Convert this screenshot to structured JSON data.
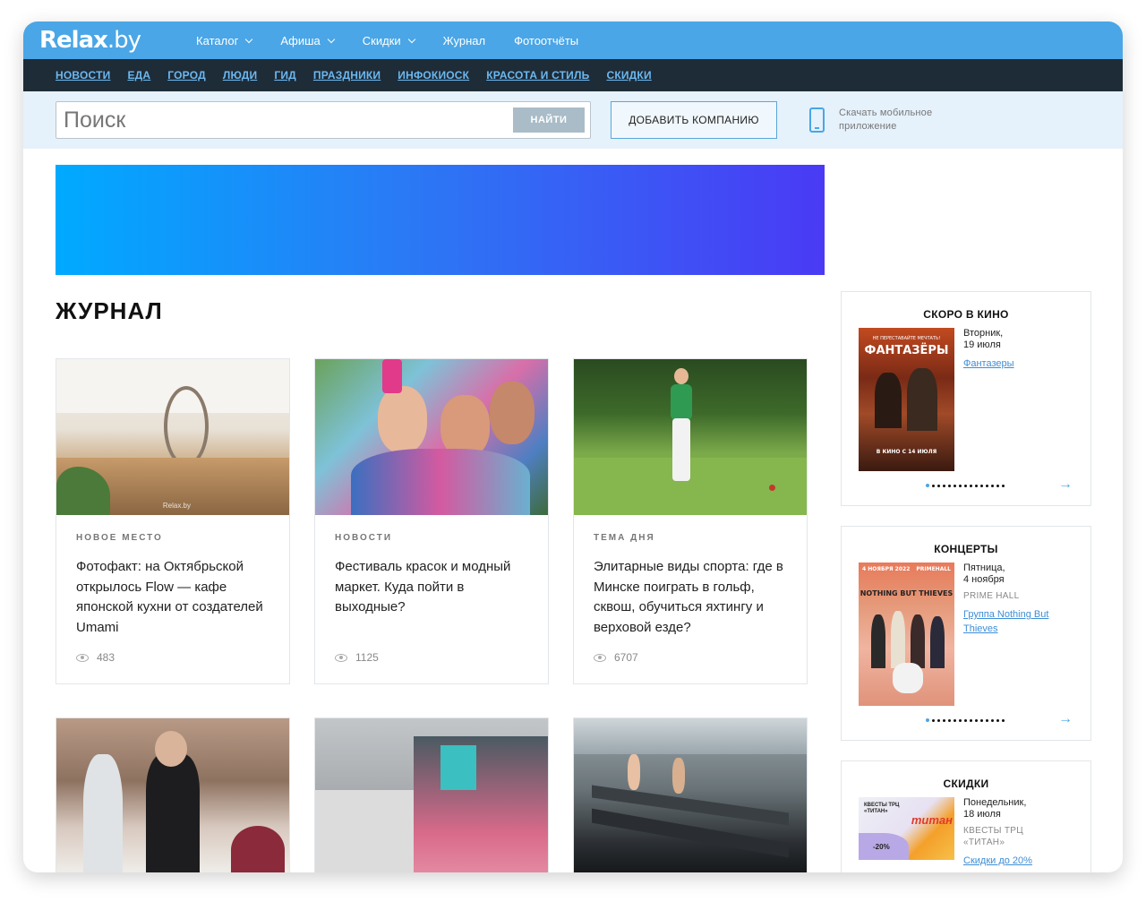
{
  "brand": {
    "logo_main": "Relax",
    "logo_tld": ".by"
  },
  "topnav": [
    {
      "label": "Каталог",
      "dropdown": true
    },
    {
      "label": "Афиша",
      "dropdown": true
    },
    {
      "label": "Скидки",
      "dropdown": true
    },
    {
      "label": "Журнал",
      "dropdown": false
    },
    {
      "label": "Фотоотчёты",
      "dropdown": false
    }
  ],
  "categories": [
    "НОВОСТИ",
    "ЕДА",
    "ГОРОД",
    "ЛЮДИ",
    "ГИД",
    "ПРАЗДНИКИ",
    "ИНФОКИОСК",
    "КРАСОТА И СТИЛЬ",
    "СКИДКИ"
  ],
  "search": {
    "placeholder": "Поиск",
    "button_label": "НАЙТИ"
  },
  "add_company_label": "ДОБАВИТЬ КОМПАНИЮ",
  "mobile_app_text": "Скачать мобильное приложение",
  "section_title": "ЖУРНАЛ",
  "articles": [
    {
      "tag": "НОВОЕ МЕСТО",
      "title": "Фотофакт: на Октябрьской открылось Flow — кафе японской кухни от создателей Umami",
      "views": "483",
      "watermark": "Relax.by"
    },
    {
      "tag": "НОВОСТИ",
      "title": "Фестиваль красок и модный маркет. Куда пойти в выходные?",
      "views": "1125"
    },
    {
      "tag": "ТЕМА ДНЯ",
      "title": "Элитарные виды спорта: где в Минске поиграть в гольф, сквош, обучиться яхтингу и верховой езде?",
      "views": "6707"
    }
  ],
  "sidebar": {
    "cinema": {
      "title": "СКОРО В КИНО",
      "date_line1": "Вторник,",
      "date_line2": "19 июля",
      "link": "Фантазеры",
      "poster_title": "ФАНТАЗЁРЫ",
      "poster_top": "НЕ ПЕРЕСТАВАЙТЕ МЕЧТАТЬ!",
      "poster_bottom": "В КИНО С 14 ИЮЛЯ"
    },
    "concerts": {
      "title": "КОНЦЕРТЫ",
      "date_line1": "Пятница,",
      "date_line2": "4 ноября",
      "venue": "PRIME HALL",
      "link": "Группа Nothing But Thieves",
      "poster_band": "NOTHING BUT THIEVES",
      "poster_date": "4 НОЯБРЯ 2022",
      "poster_venue": "PRIMEHALL"
    },
    "discounts": {
      "title": "СКИДКИ",
      "date_line1": "Понедельник,",
      "date_line2": "18 июля",
      "venue": "КВЕСТЫ ТРЦ «ТИТАН»",
      "link": "Скидки до 20%",
      "poster_label": "КВЕСТЫ ТРЦ «ТИТАН»",
      "poster_percent": "-20%",
      "poster_word": "титан"
    }
  },
  "colors": {
    "accent": "#4aa6e6",
    "catbar_bg": "#1e2c38",
    "link": "#3d8ed6"
  }
}
